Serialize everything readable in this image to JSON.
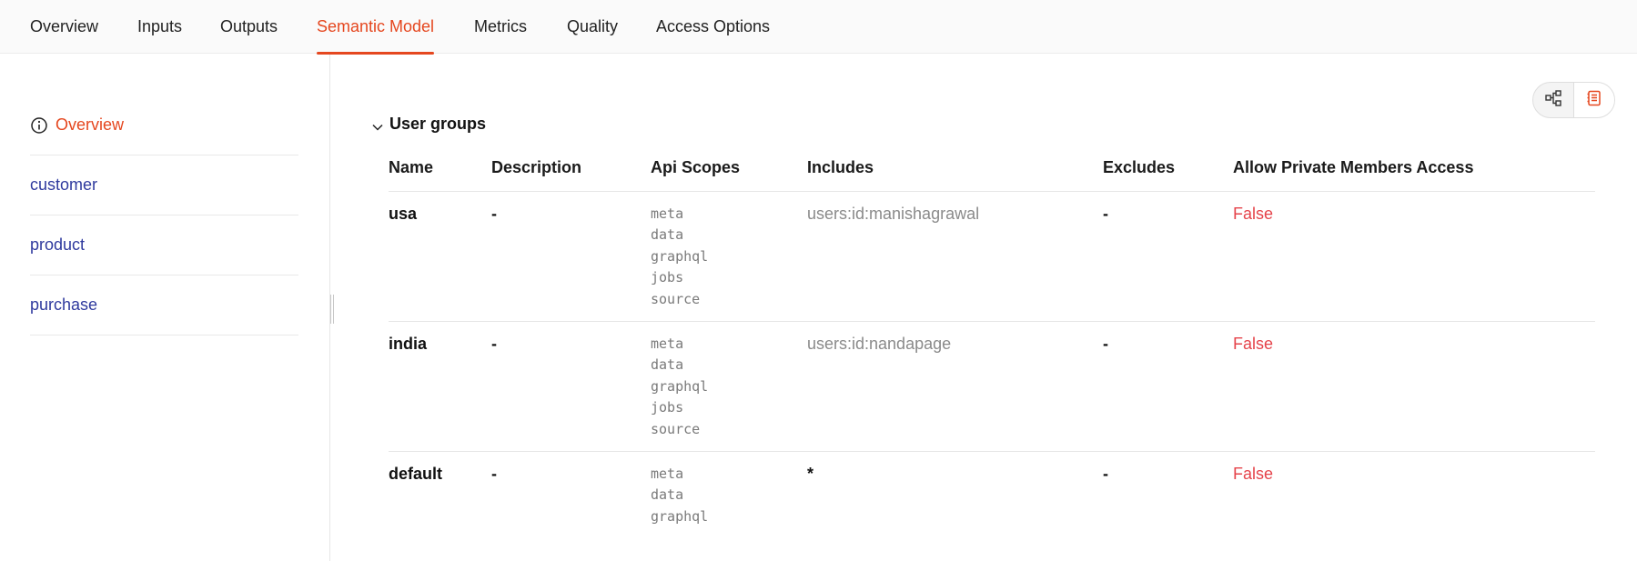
{
  "tabs": [
    {
      "label": "Overview",
      "active": false
    },
    {
      "label": "Inputs",
      "active": false
    },
    {
      "label": "Outputs",
      "active": false
    },
    {
      "label": "Semantic Model",
      "active": true
    },
    {
      "label": "Metrics",
      "active": false
    },
    {
      "label": "Quality",
      "active": false
    },
    {
      "label": "Access Options",
      "active": false
    }
  ],
  "sidebar": {
    "items": [
      {
        "label": "Overview",
        "icon": "info-icon",
        "active": true
      },
      {
        "label": "customer"
      },
      {
        "label": "product"
      },
      {
        "label": "purchase"
      }
    ]
  },
  "view_toggle": {
    "options": [
      {
        "icon": "graph-icon",
        "selected": false
      },
      {
        "icon": "document-icon",
        "selected": true
      }
    ]
  },
  "user_groups": {
    "title": "User groups",
    "columns": [
      "Name",
      "Description",
      "Api Scopes",
      "Includes",
      "Excludes",
      "Allow Private Members Access"
    ],
    "rows": [
      {
        "name": "usa",
        "description": "-",
        "scopes": [
          "meta",
          "data",
          "graphql",
          "jobs",
          "source"
        ],
        "includes": "users:id:manishagrawal",
        "excludes": "-",
        "allow_private": "False"
      },
      {
        "name": "india",
        "description": "-",
        "scopes": [
          "meta",
          "data",
          "graphql",
          "jobs",
          "source"
        ],
        "includes": "users:id:nandapage",
        "excludes": "-",
        "allow_private": "False"
      },
      {
        "name": "default",
        "description": "-",
        "scopes": [
          "meta",
          "data",
          "graphql"
        ],
        "includes": "*",
        "excludes": "-",
        "allow_private": "False"
      }
    ]
  },
  "colors": {
    "accent": "#e5471f",
    "link": "#2f3a9e",
    "false_text": "#e5434a"
  }
}
